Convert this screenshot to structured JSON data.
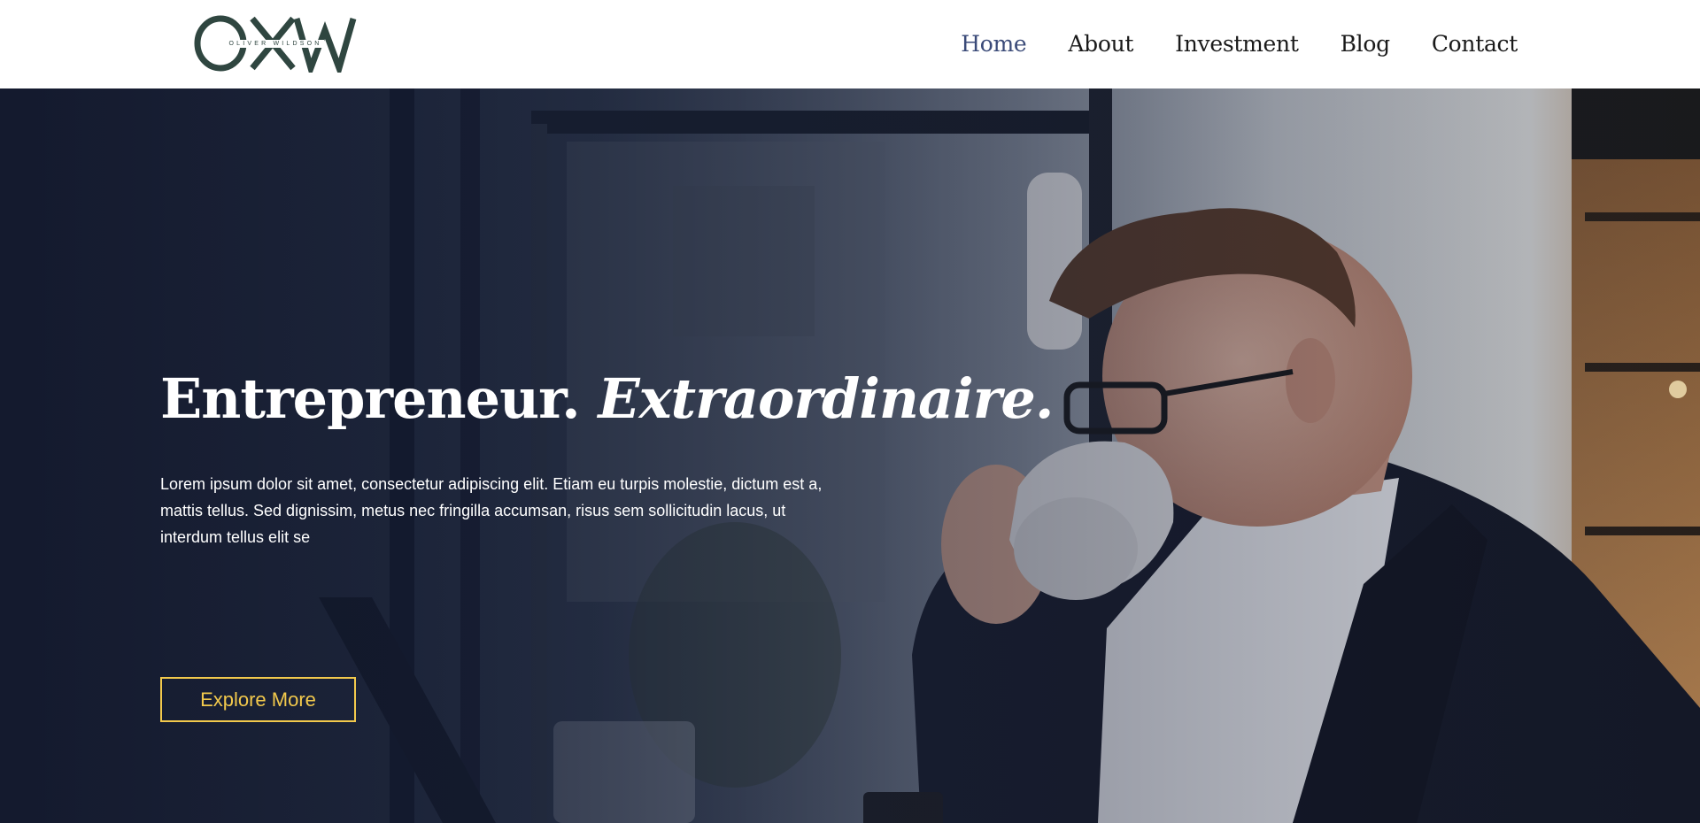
{
  "brand": {
    "monogram": "OXW",
    "name": "OLIVER WILDSON",
    "color": "#2f4640"
  },
  "nav": {
    "items": [
      {
        "label": "Home",
        "active": true
      },
      {
        "label": "About",
        "active": false
      },
      {
        "label": "Investment",
        "active": false
      },
      {
        "label": "Blog",
        "active": false
      },
      {
        "label": "Contact",
        "active": false
      }
    ],
    "active_color": "#3a4a78"
  },
  "hero": {
    "title_plain": "Entrepreneur.",
    "title_italic": "Extraordinaire.",
    "body": "Lorem ipsum dolor sit amet, consectetur adipiscing elit. Etiam eu turpis molestie, dictum est a, mattis tellus. Sed dignissim, metus nec fringilla accumsan, risus sem sollicitudin lacus, ut interdum tellus elit se",
    "cta_label": "Explore More",
    "cta_color": "#f2c94c",
    "image_subject": "man-in-suit-drinking-coffee-photo"
  }
}
